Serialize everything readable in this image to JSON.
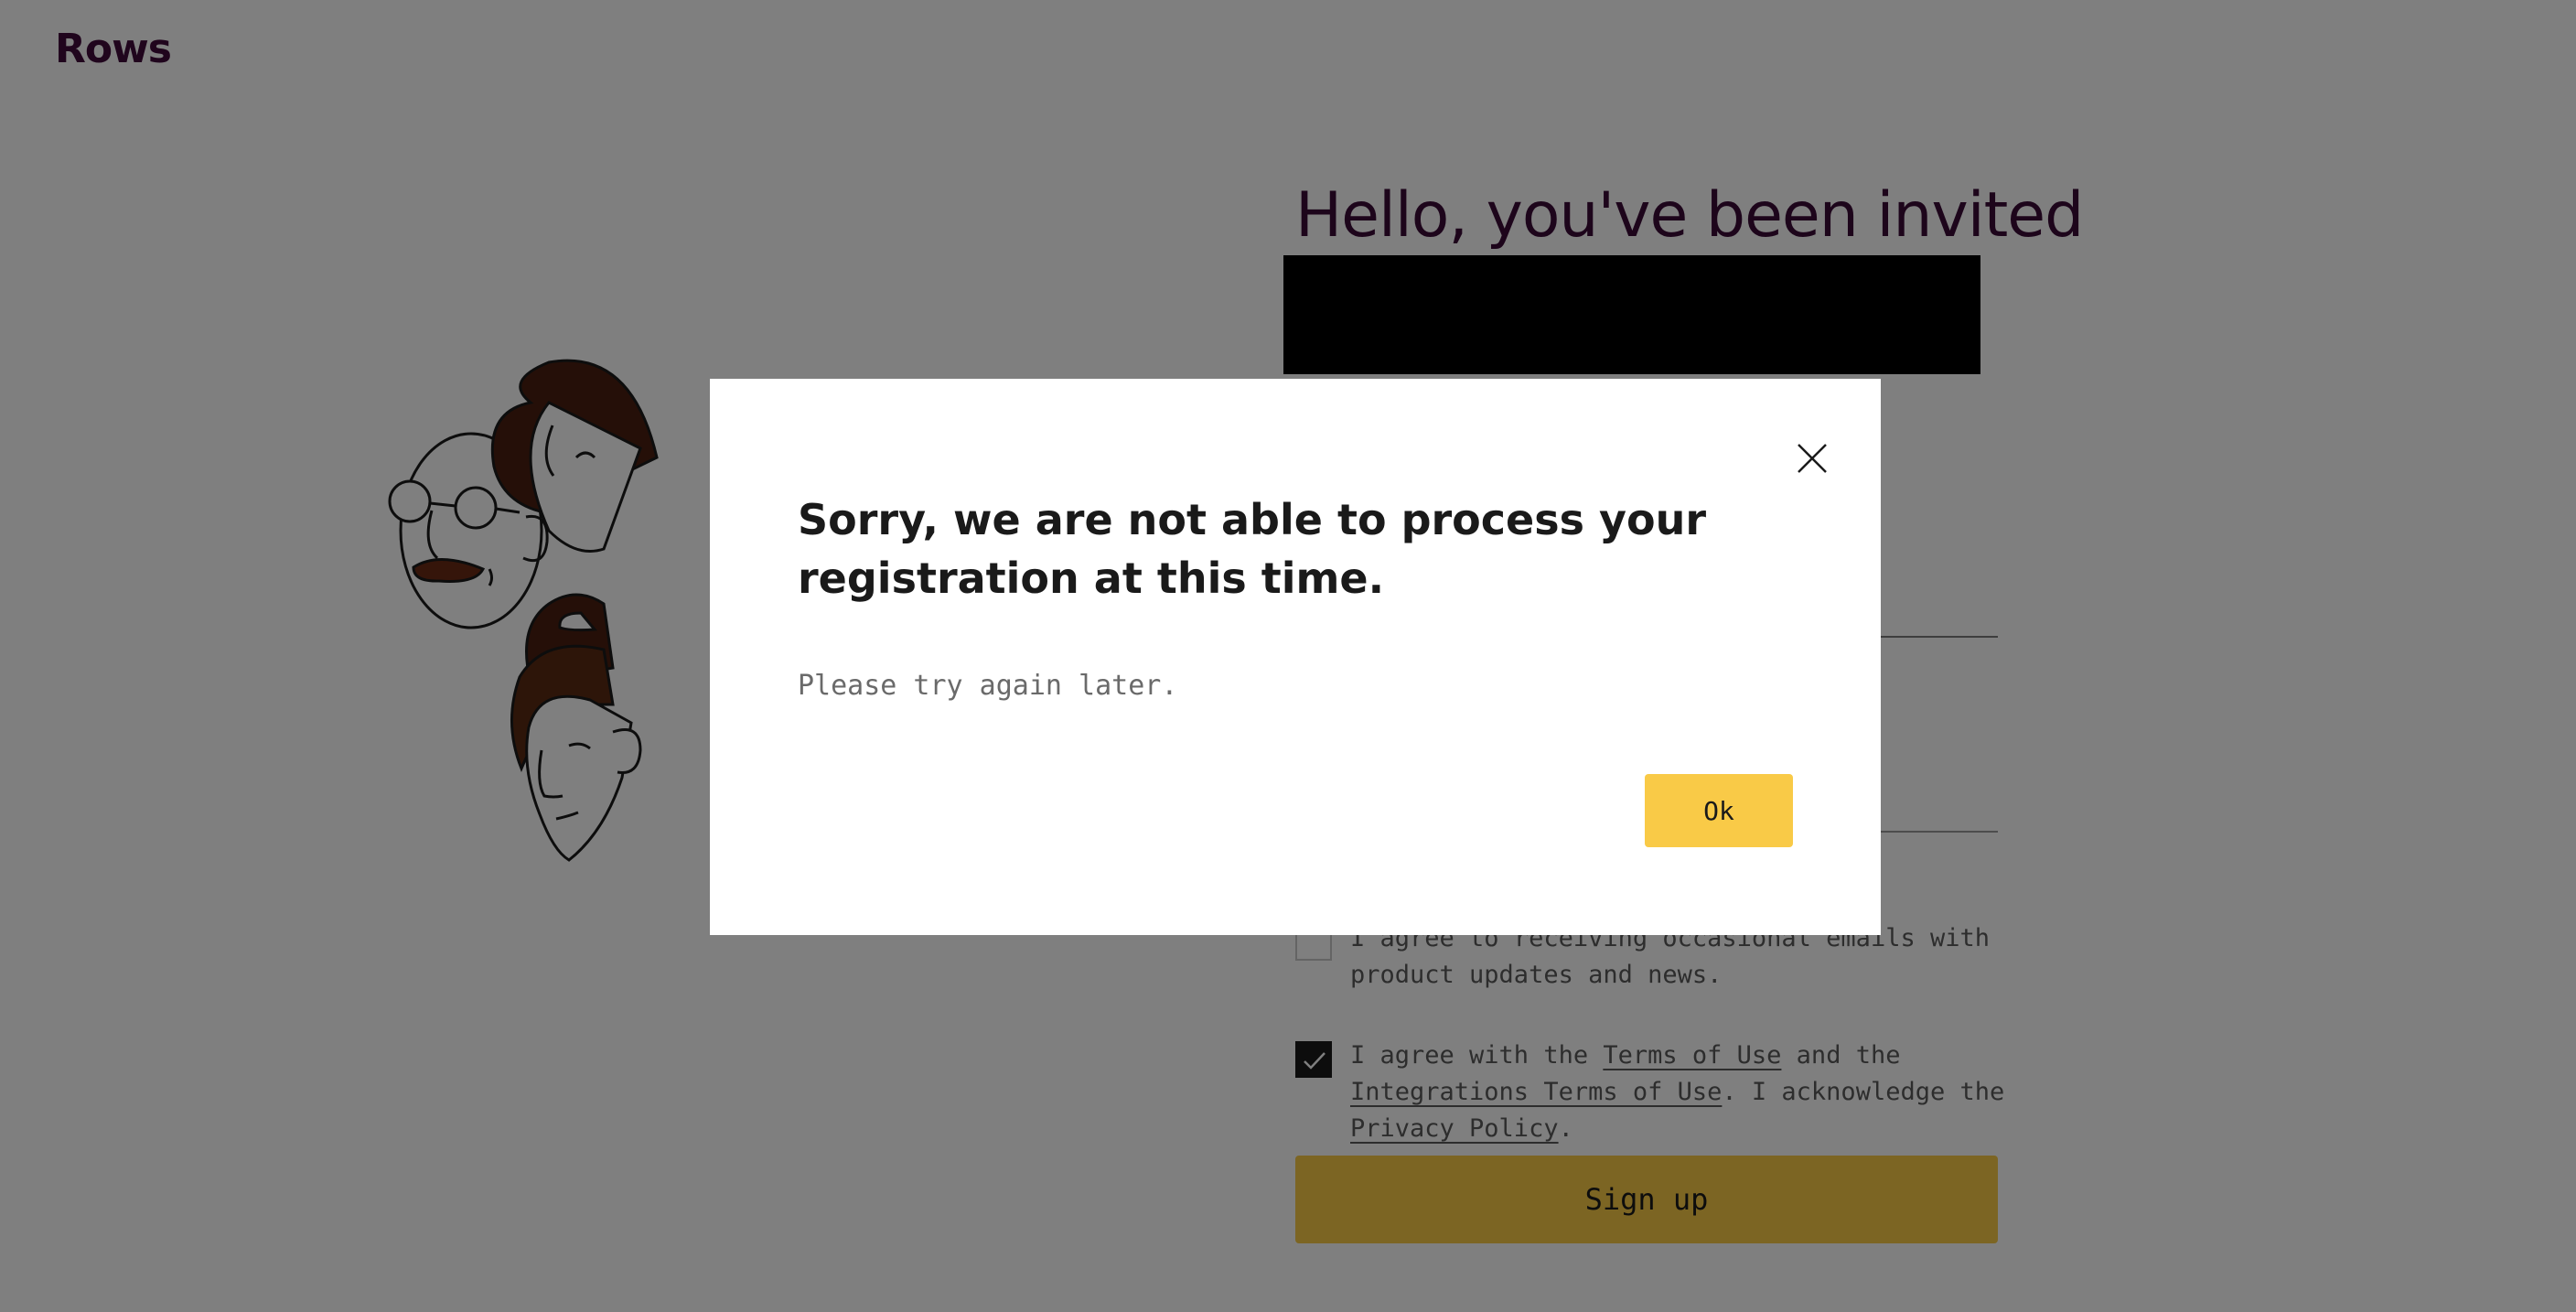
{
  "app": {
    "logo": "Rows"
  },
  "invite": {
    "title": "Hello, you've been invited"
  },
  "consents": [
    {
      "text": "I agree to receiving occasional emails with product updates and news.",
      "checked": false
    },
    {
      "checked": true,
      "parts": {
        "p1": "I agree with the ",
        "terms": "Terms of Use",
        "p2": " and the ",
        "integrations": "Integrations Terms of Use",
        "p3": ". I acknowledge the ",
        "privacy": "Privacy Policy",
        "p4": "."
      }
    }
  ],
  "signup": {
    "label": "Sign up"
  },
  "dialog": {
    "title": "Sorry, we are not able to process your registration at this time.",
    "message": "Please try again later.",
    "ok_label": "Ok"
  },
  "colors": {
    "accent": "#f9ca47",
    "brand": "#400a3a",
    "hair": "#4a1f10",
    "mustache": "#6b2a14"
  },
  "icons": {
    "close": "close-icon",
    "check": "checkmark-icon"
  }
}
